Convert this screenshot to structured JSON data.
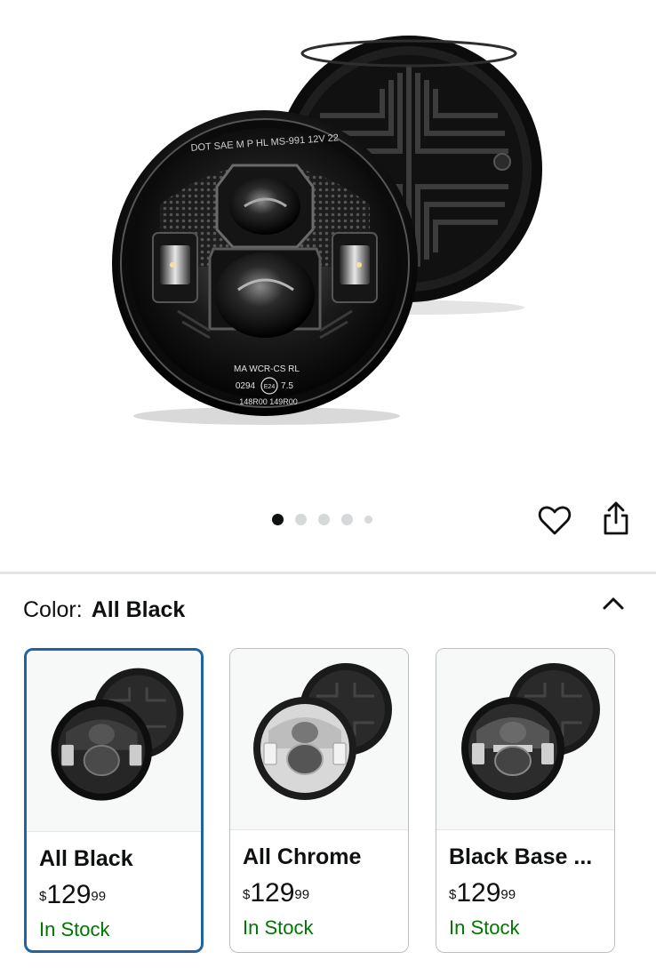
{
  "gallery": {
    "hero_alt": "Round LED headlight pair",
    "lens_text_top": "DOT SAE M P HL  MS-991 12V 22",
    "lens_text_bottom_1": "MA WCR-CS RL",
    "lens_text_bottom_2": "0294",
    "lens_text_bottom_badge": "E24",
    "lens_text_bottom_3": "7.5",
    "lens_text_bottom_4": "148R00  149R00",
    "dot_count": 5,
    "active_dot": 0
  },
  "actions": {
    "favorite_icon": "heart-icon",
    "share_icon": "share-icon"
  },
  "variation": {
    "label": "Color:",
    "selected": "All Black",
    "collapse_icon": "chevron-up-icon"
  },
  "options": [
    {
      "name": "All Black",
      "currency": "$",
      "price_whole": "129",
      "price_fraction": "99",
      "stock": "In Stock",
      "selected": true,
      "finish": "black"
    },
    {
      "name": "All Chrome",
      "currency": "$",
      "price_whole": "129",
      "price_fraction": "99",
      "stock": "In Stock",
      "selected": false,
      "finish": "chrome"
    },
    {
      "name": "Black Base ...",
      "currency": "$",
      "price_whole": "129",
      "price_fraction": "99",
      "stock": "In Stock",
      "selected": false,
      "finish": "blackbase"
    }
  ],
  "colors": {
    "selected_border": "#2162a1",
    "stock_green": "#007600",
    "text": "#0f1111"
  }
}
